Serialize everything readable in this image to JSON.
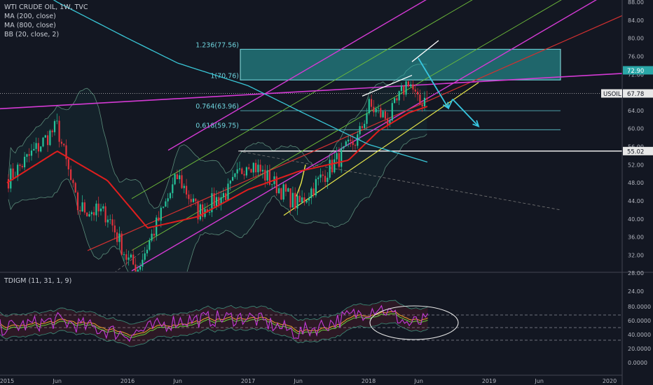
{
  "legend_main": {
    "title": "WTI CRUDE OIL, 1W, TVC",
    "ma200": "MA (200, close)",
    "ma800": "MA (800, close)",
    "bb": "BB (20, close, 2)"
  },
  "legend_osc": {
    "title": "TDIGM (11, 31, 1, 9)"
  },
  "price_tags": {
    "symbol": "USOIL",
    "usoil": "67.78",
    "zone_top": "72.90",
    "support": "55.02"
  },
  "fib_levels": [
    {
      "label": "1.236(77.56)",
      "price": 77.56
    },
    {
      "label": "1(70.76)",
      "price": 70.76
    },
    {
      "label": "0.764(63.96)",
      "price": 63.96
    },
    {
      "label": "0.618(59.75)",
      "price": 59.75
    }
  ],
  "colors": {
    "background": "#131722",
    "candle_up": "#26c39a",
    "candle_down": "#e0323c",
    "ma200": "#e01e1e",
    "ma800": "#39c6d6",
    "channel": "#d43ad4",
    "fan": "#6fbf3a",
    "trend_yellow": "#e8e84a",
    "arrow": "#37c6e0",
    "zone": "#2aa7a8"
  },
  "chart_data": [
    {
      "type": "candlestick",
      "title": "WTI CRUDE OIL, 1W, TVC",
      "ylim": [
        24,
        88
      ],
      "y_ticks": [
        "88.00",
        "84.00",
        "80.00",
        "76.00",
        "72.00",
        "68.00",
        "64.00",
        "60.00",
        "56.00",
        "52.00",
        "48.00",
        "44.00",
        "40.00",
        "36.00",
        "32.00",
        "28.00",
        "24.00"
      ],
      "x_ticks": [
        "2015",
        "Jun",
        "2016",
        "Jun",
        "2017",
        "Jun",
        "2018",
        "Jun",
        "2019",
        "Jun",
        "2020"
      ],
      "series": [
        {
          "name": "WTI Crude Oil weekly close (approx.)",
          "x": [
            "2015-01",
            "2015-06",
            "2015-08",
            "2015-11",
            "2016-01",
            "2016-02",
            "2016-06",
            "2016-08",
            "2016-11",
            "2017-01",
            "2017-06",
            "2017-09",
            "2017-12",
            "2018-01",
            "2018-03",
            "2018-05",
            "2018-06",
            "2018-07"
          ],
          "values": [
            48.5,
            60.5,
            42.5,
            41.0,
            31.0,
            29.0,
            49.5,
            41.5,
            46.0,
            53.0,
            43.0,
            51.0,
            58.0,
            65.0,
            62.0,
            71.0,
            65.0,
            68.5
          ]
        },
        {
          "name": "MA (200, close)",
          "x": [
            "2015-01",
            "2015-06",
            "2015-11",
            "2016-03",
            "2016-08",
            "2017-01",
            "2017-06",
            "2017-11",
            "2018-02",
            "2018-05",
            "2018-07"
          ],
          "values": [
            48.0,
            55.0,
            48.5,
            38.0,
            40.5,
            46.5,
            50.5,
            53.0,
            59.5,
            63.5,
            65.0
          ]
        },
        {
          "name": "MA (800, close)",
          "x": [
            "2015-01",
            "2015-06",
            "2016-01",
            "2016-06",
            "2017-01",
            "2017-06",
            "2018-01",
            "2018-07"
          ],
          "values": [
            95.0,
            88.0,
            80.0,
            74.5,
            69.5,
            64.0,
            56.5,
            52.5
          ]
        }
      ]
    },
    {
      "type": "line",
      "title": "TDIGM (11, 31, 1, 9)",
      "ylim": [
        -10,
        95
      ],
      "y_ticks": [
        "80.0000",
        "60.0000",
        "40.0000",
        "20.0000",
        "0.0000"
      ],
      "series": [
        {
          "name": "TDIGM",
          "x": [
            "2015-01",
            "2015-06",
            "2016-01",
            "2016-06",
            "2017-01",
            "2017-06",
            "2018-01",
            "2018-02",
            "2018-05",
            "2018-07"
          ],
          "values": [
            50,
            60,
            40,
            60,
            65,
            42,
            75,
            80,
            55,
            60
          ]
        }
      ]
    }
  ]
}
